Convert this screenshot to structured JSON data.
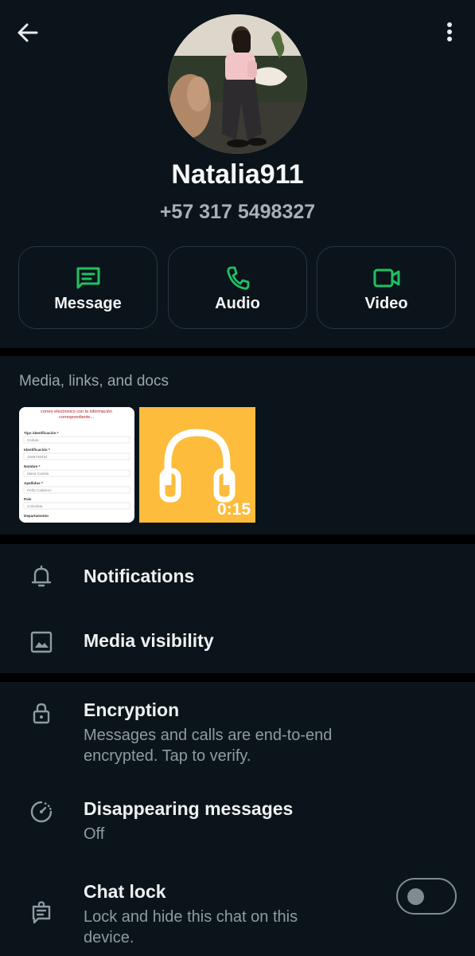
{
  "contact": {
    "name": "Natalia911",
    "phone": "+57 317 5498327"
  },
  "actions": [
    {
      "label": "Message",
      "icon": "message-icon"
    },
    {
      "label": "Audio",
      "icon": "phone-icon"
    },
    {
      "label": "Video",
      "icon": "video-icon"
    }
  ],
  "media": {
    "title": "Media, links, and docs",
    "doc_thumb": {
      "header": "correo electronico con la información correspondiente...",
      "fields": [
        {
          "label": "Tipo identificación *",
          "value": "Cedula"
        },
        {
          "label": "Identificación *",
          "value": "1069748494"
        },
        {
          "label": "Nombre *",
          "value": "Maria Camila"
        },
        {
          "label": "Apellidos *",
          "value": "Peña Calderon"
        },
        {
          "label": "País",
          "value": "Colombia"
        },
        {
          "label": "Departamento",
          "value": ""
        }
      ]
    },
    "audio_thumb": {
      "duration": "0:15",
      "icon": "headphones-icon",
      "color": "#fdbc3c"
    }
  },
  "settings": {
    "notifications": "Notifications",
    "media_visibility": "Media visibility"
  },
  "privacy": {
    "encryption_title": "Encryption",
    "encryption_sub": "Messages and calls are end-to-end encrypted. Tap to verify.",
    "disappearing_title": "Disappearing messages",
    "disappearing_sub": "Off",
    "chatlock_title": "Chat lock",
    "chatlock_sub": "Lock and hide this chat on this device.",
    "chatlock_enabled": false
  },
  "colors": {
    "accent": "#21c063",
    "background": "#0b141a",
    "audio_tile": "#fdbc3c"
  }
}
